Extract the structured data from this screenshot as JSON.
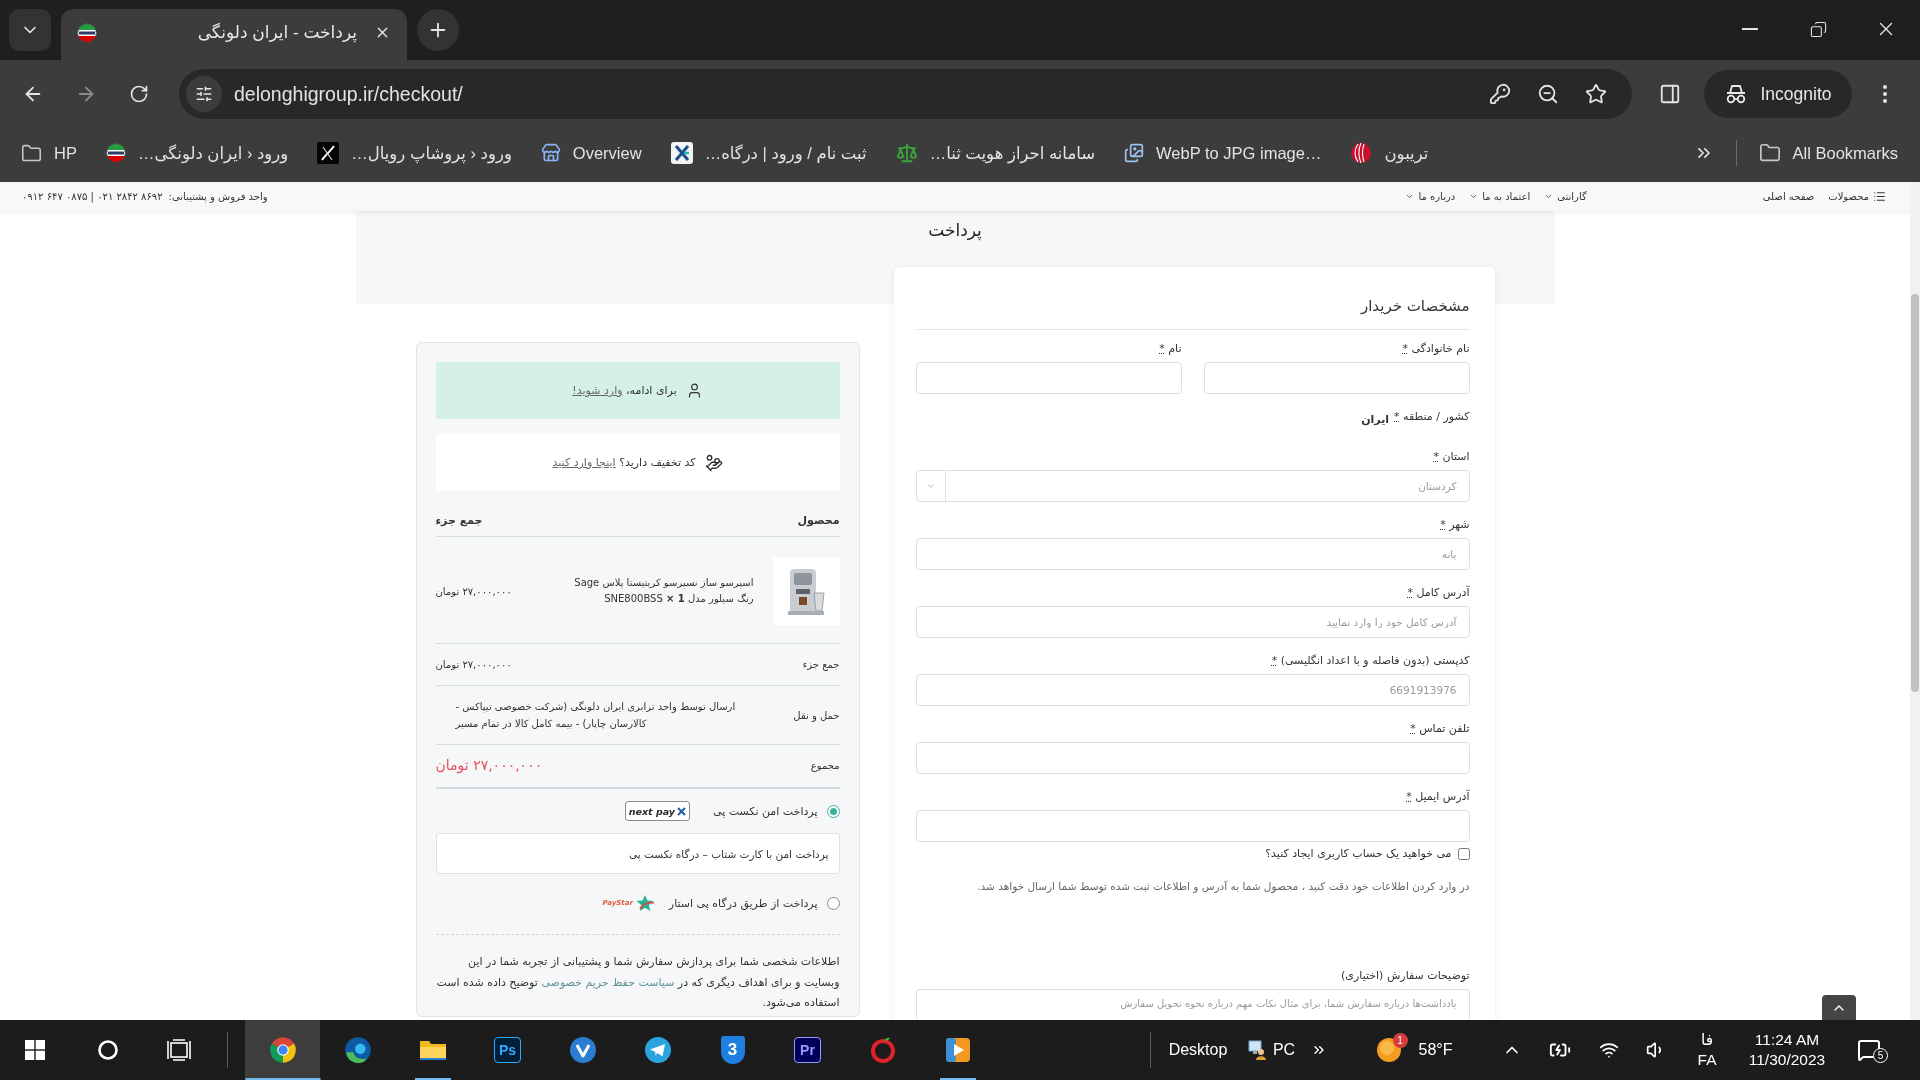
{
  "browser": {
    "tabs": [
      {
        "title": "پرداخت - ایران دلونگی",
        "selected": true
      }
    ],
    "url": "delonghigroup.ir/checkout/",
    "profile": "Incognito",
    "bookmarks": [
      {
        "kind": "sphere",
        "label": "تریبون"
      },
      {
        "kind": "image",
        "label": "WebP to JPG image…"
      },
      {
        "kind": "scales",
        "label": "سامانه احراز هویت ثنا…"
      },
      {
        "kind": "cross",
        "label": "ثبت نام / ورود | درگاه…"
      },
      {
        "kind": "store",
        "label": "Overview"
      },
      {
        "kind": "tile",
        "label": "ورود ‹ پروشاپ رویال…"
      },
      {
        "kind": "flag",
        "label": "ورود ‹ ایران دلونگی…"
      },
      {
        "kind": "folder",
        "label": "HP"
      }
    ],
    "all_bookmarks": "All Bookmarks"
  },
  "site_header": {
    "support_label": "واحد فروش و پشتیبانی:",
    "phones": "۰۹۱۲ ۶۴۷ ۰۸۷۵ | ۰۲۱ ۲۸۴۲ ۸۶۹۲",
    "menu": [
      {
        "kind": "products",
        "label": "محصولات"
      },
      {
        "kind": "link",
        "label": "صفحه اصلی"
      },
      {
        "kind": "dropdown",
        "label": "گارانتی"
      },
      {
        "kind": "dropdown",
        "label": "اعتماد به ما"
      },
      {
        "kind": "dropdown",
        "label": "درباره ما"
      }
    ]
  },
  "page_title": "پرداخت",
  "billing": {
    "title": "مشخصات خریدار",
    "name_fields": [
      {
        "label": "نام خانوادگی",
        "required_mark": "*"
      },
      {
        "label": "نام",
        "required_mark": "*"
      }
    ],
    "country": {
      "label": "کشور / منطقه",
      "required_mark": "*",
      "value": "ایران"
    },
    "fields": [
      {
        "kind": "select",
        "label": "استان",
        "required_mark": "*",
        "placeholder": "کردستان"
      },
      {
        "kind": "input",
        "label": "شهر",
        "required_mark": "*",
        "placeholder": "بانه"
      },
      {
        "kind": "input",
        "label": "آدرس کامل",
        "required_mark": "*",
        "placeholder": "آدرس کامل خود را وارد نمایید"
      },
      {
        "kind": "input",
        "label": "کدپستی (بدون فاصله و با اعداد انگلیسی)",
        "required_mark": "*",
        "placeholder": "6691913976"
      },
      {
        "kind": "input",
        "label": "تلفن تماس",
        "required_mark": "*"
      },
      {
        "kind": "input",
        "label": "آدرس ایمیل",
        "required_mark": "*"
      }
    ],
    "create_account": {
      "label": "می خواهید یک حساب کاربری ایجاد کنید؟",
      "checked": false
    },
    "note": "در وارد کردن اطلاعات خود دقت کنید ، محصول شما به آدرس و اطلاعات ثبت شده توسط شما ارسال خواهد شد.",
    "order_notes": {
      "label": "توضیحات سفارش (اختیاری)",
      "placeholder": "یادداشت‌ها درباره سفارش شما، برای مثال نکات مهم درباره نحوه تحویل سفارش"
    }
  },
  "order": {
    "login_notice": {
      "text": "برای ادامه،",
      "link": "وارد شوید!"
    },
    "coupon_notice": {
      "text": "کد تخفیف دارید؟",
      "link": "اینجا وارد کنید"
    },
    "columns": [
      "محصول",
      "جمع جزء"
    ],
    "items": [
      {
        "name": "اسپرسو ساز نسپرسو کریتیستا پلاس Sage رنگ سیلور مدل SNE800BSS **× 1**",
        "total": "۲۷,۰۰۰,۰۰۰ تومان"
      }
    ],
    "totals": [
      {
        "kind": "subtotal",
        "label": "جمع جزء",
        "value": "۲۷,۰۰۰,۰۰۰ تومان"
      },
      {
        "kind": "shipping",
        "label": "حمل و نقل",
        "value": "ارسال توسط واحد ترابری ایران دلونگی (شرکت خصوصی تیپاکس - کالارسان چاپار) - بیمه کامل کالا در تمام مسیر"
      },
      {
        "kind": "total",
        "label": "مجموع",
        "value": "۲۷,۰۰۰,۰۰۰ تومان"
      }
    ],
    "payment_methods": [
      {
        "kind": "nextpay",
        "label": "پرداخت امن نکست پی",
        "logo": "next pay",
        "selected": true,
        "description": "پرداخت امن با کارت شتاب – درگاه نکست پی"
      },
      {
        "kind": "paystar",
        "label": "پرداخت از طریق درگاه پی استار",
        "logo": "PayStar",
        "selected": false
      }
    ],
    "privacy": {
      "before": "اطلاعات شخصی شما برای پردازش سفارش شما و پشتیبانی از تجربه شما در این وبسایت و برای اهداف دیگری که در",
      "link": "سیاست حفظ حریم خصوصی",
      "after": "توضیح داده شده است استفاده می‌شود."
    }
  },
  "taskbar": {
    "apps": [
      {
        "kind": "player",
        "active": false,
        "running": true
      },
      {
        "kind": "ring",
        "active": false,
        "running": false
      },
      {
        "kind": "pr",
        "glyph": "Pr",
        "active": false,
        "running": false
      },
      {
        "kind": "shield",
        "glyph": "3",
        "active": false,
        "running": false
      },
      {
        "kind": "telegram",
        "active": false,
        "running": false
      },
      {
        "kind": "vee",
        "active": false,
        "running": false
      },
      {
        "kind": "ps",
        "glyph": "Ps",
        "active": false,
        "running": false
      },
      {
        "kind": "files",
        "active": false,
        "running": true
      },
      {
        "kind": "edge",
        "active": false,
        "running": false
      },
      {
        "kind": "chrome",
        "active": true,
        "running": true
      }
    ],
    "toolbar_label": "Desktop",
    "pc_label": "PC",
    "weather_badge": "1",
    "temperature": "58°F",
    "language": {
      "native": "فا",
      "code": "FA"
    },
    "time": "11:24 AM",
    "date": "11/30/2023",
    "notification_count": "5"
  }
}
